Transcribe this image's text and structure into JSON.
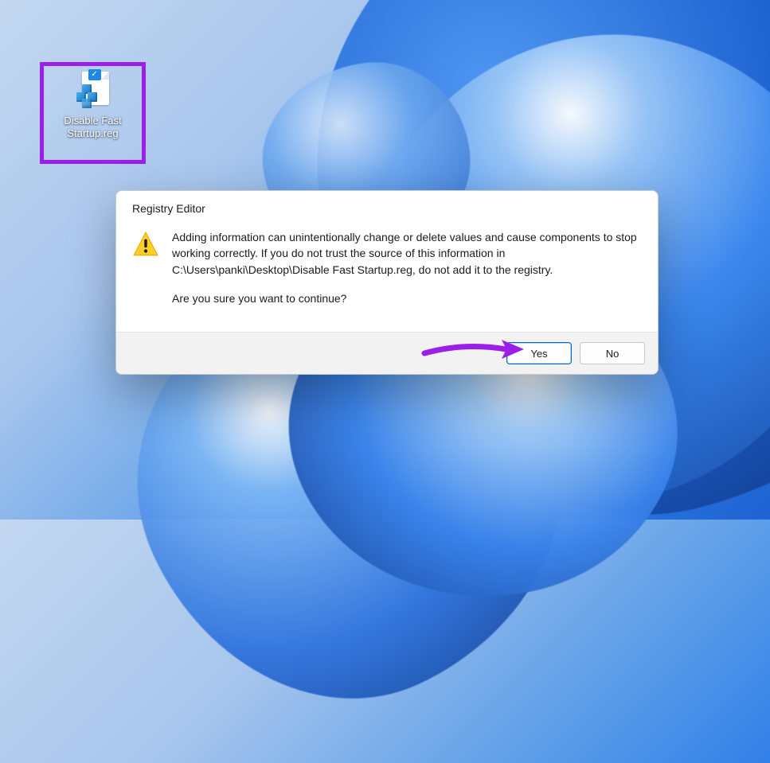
{
  "desktop": {
    "file_label": "Disable Fast\nStartup.reg",
    "file_icon_name": "registry-file-icon"
  },
  "dialog": {
    "title": "Registry Editor",
    "message": "Adding information can unintentionally change or delete values and cause components to stop working correctly. If you do not trust the source of this information in C:\\Users\\panki\\Desktop\\Disable Fast Startup.reg, do not add it to the registry.",
    "confirm": "Are you sure you want to continue?",
    "buttons": {
      "yes": "Yes",
      "no": "No"
    },
    "icon_name": "warning-icon"
  },
  "annotation": {
    "highlight_color": "#9b1fe8",
    "arrow_color": "#9b1fe8"
  }
}
